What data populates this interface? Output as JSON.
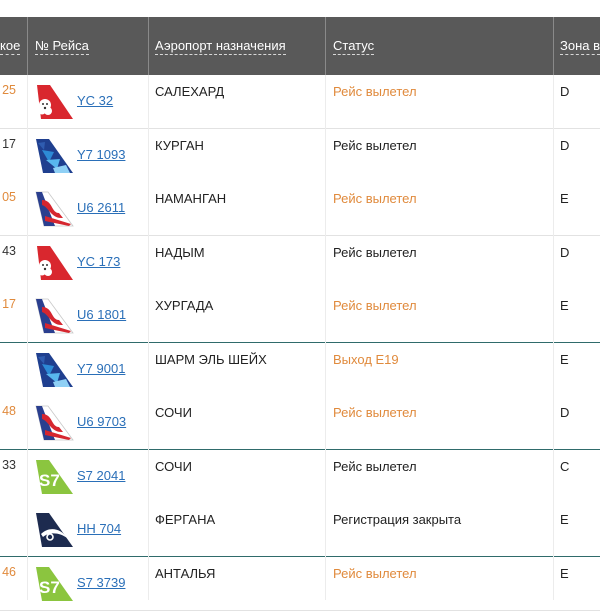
{
  "table": {
    "headers": {
      "col0": "кое",
      "flight": "№ Рейса",
      "destination": "Аэропорт назначения",
      "status": "Статус",
      "zone": "Зона в"
    },
    "rows": [
      {
        "time": "25",
        "time_color": "orange",
        "airline": "yamal",
        "flight": "YC 32",
        "destination": "САЛЕХАРД",
        "status": "Рейс вылетел",
        "status_color": "orange",
        "zone": "D"
      },
      {
        "time": "17",
        "time_color": "gray",
        "airline": "azur",
        "flight": "Y7 1093",
        "destination": "КУРГАН",
        "status": "Рейс вылетел",
        "status_color": "gray",
        "zone": "D"
      },
      {
        "time": "05",
        "time_color": "orange",
        "airline": "ural",
        "flight": "U6 2611",
        "destination": "НАМАНГАН",
        "status": "Рейс вылетел",
        "status_color": "orange",
        "zone": "E"
      },
      {
        "time": "43",
        "time_color": "gray",
        "airline": "yamal",
        "flight": "YC 173",
        "destination": "НАДЫМ",
        "status": "Рейс вылетел",
        "status_color": "gray",
        "zone": "D"
      },
      {
        "time": "17",
        "time_color": "orange",
        "airline": "ural",
        "flight": "U6 1801",
        "destination": "ХУРГАДА",
        "status": "Рейс вылетел",
        "status_color": "orange",
        "zone": "E"
      },
      {
        "time": "",
        "time_color": "gray",
        "airline": "azur",
        "flight": "Y7 9001",
        "destination": "ШАРМ ЭЛЬ ШЕЙХ",
        "status": "Выход E19",
        "status_color": "orange",
        "zone": "E"
      },
      {
        "time": "48",
        "time_color": "orange",
        "airline": "ural",
        "flight": "U6 9703",
        "destination": "СОЧИ",
        "status": "Рейс вылетел",
        "status_color": "orange",
        "zone": "D"
      },
      {
        "time": "33",
        "time_color": "gray",
        "airline": "s7",
        "flight": "S7 2041",
        "destination": "СОЧИ",
        "status": "Рейс вылетел",
        "status_color": "gray",
        "zone": "C"
      },
      {
        "time": "",
        "time_color": "gray",
        "airline": "nordwind",
        "flight": "HH 704",
        "destination": "ФЕРГАНА",
        "status": "Регистрация закрыта",
        "status_color": "gray",
        "zone": "E"
      },
      {
        "time": "46",
        "time_color": "orange",
        "airline": "s7",
        "flight": "S7 3739",
        "destination": "АНТАЛЬЯ",
        "status": "Рейс вылетел",
        "status_color": "orange",
        "zone": "E"
      }
    ]
  },
  "colors": {
    "header_bg": "#595959",
    "accent_orange": "#e08a3c",
    "link_blue": "#2a6fb8",
    "teal_separator": "#2f6b6b"
  }
}
